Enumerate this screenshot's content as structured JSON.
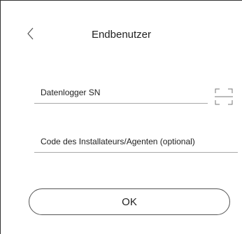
{
  "header": {
    "title": "Endbenutzer",
    "back_icon": "chevron-left-icon"
  },
  "form": {
    "datalogger": {
      "label": "Datenlogger SN",
      "scan_icon": "scan-icon"
    },
    "installer_code": {
      "label": "Code des Installateurs/Agenten (optional)"
    },
    "ok_label": "OK"
  }
}
